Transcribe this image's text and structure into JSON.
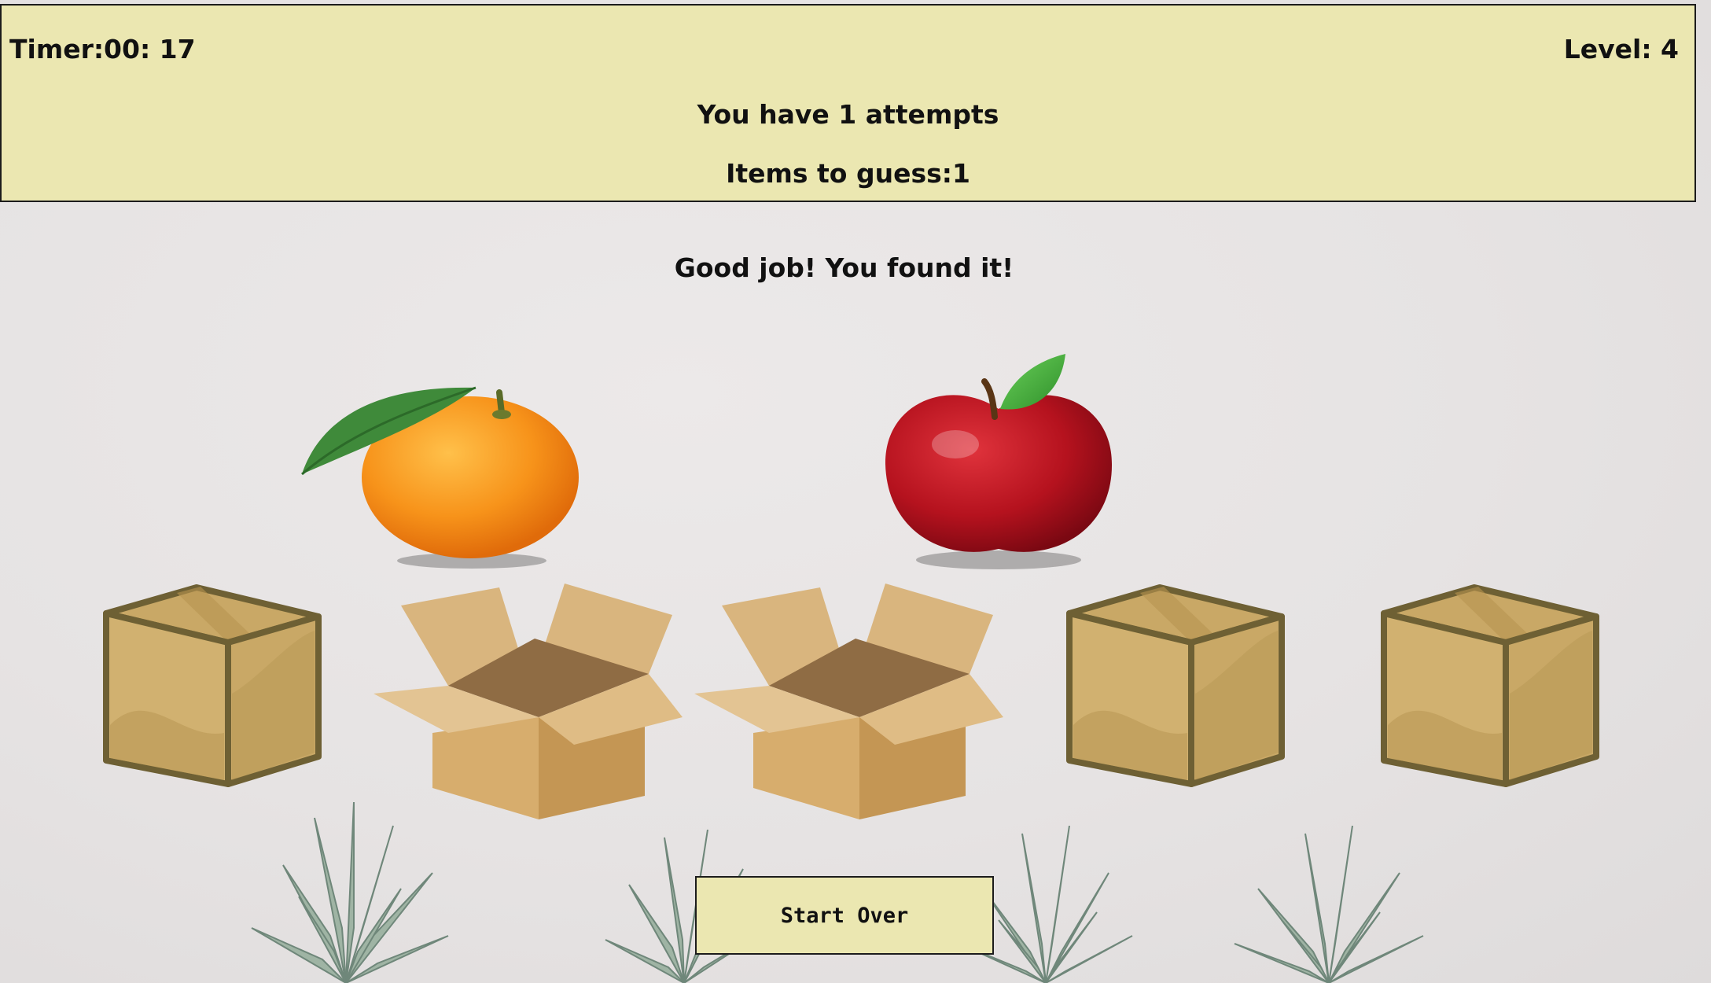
{
  "header": {
    "timer": "Timer:00: 17",
    "level": "Level: 4",
    "attempts": "You have 1 attempts",
    "items_to_guess": "Items to guess:1"
  },
  "message": "Good job! You found it!",
  "start_over_label": "Start Over",
  "boxes": [
    {
      "state": "closed"
    },
    {
      "state": "open",
      "revealed": "orange"
    },
    {
      "state": "open",
      "revealed": "apple"
    },
    {
      "state": "closed"
    },
    {
      "state": "closed"
    }
  ],
  "colors": {
    "panel": "#ebe7b1",
    "box_closed": "#c9a866",
    "box_outline": "#6e6034",
    "box_open": "#d4af78"
  }
}
